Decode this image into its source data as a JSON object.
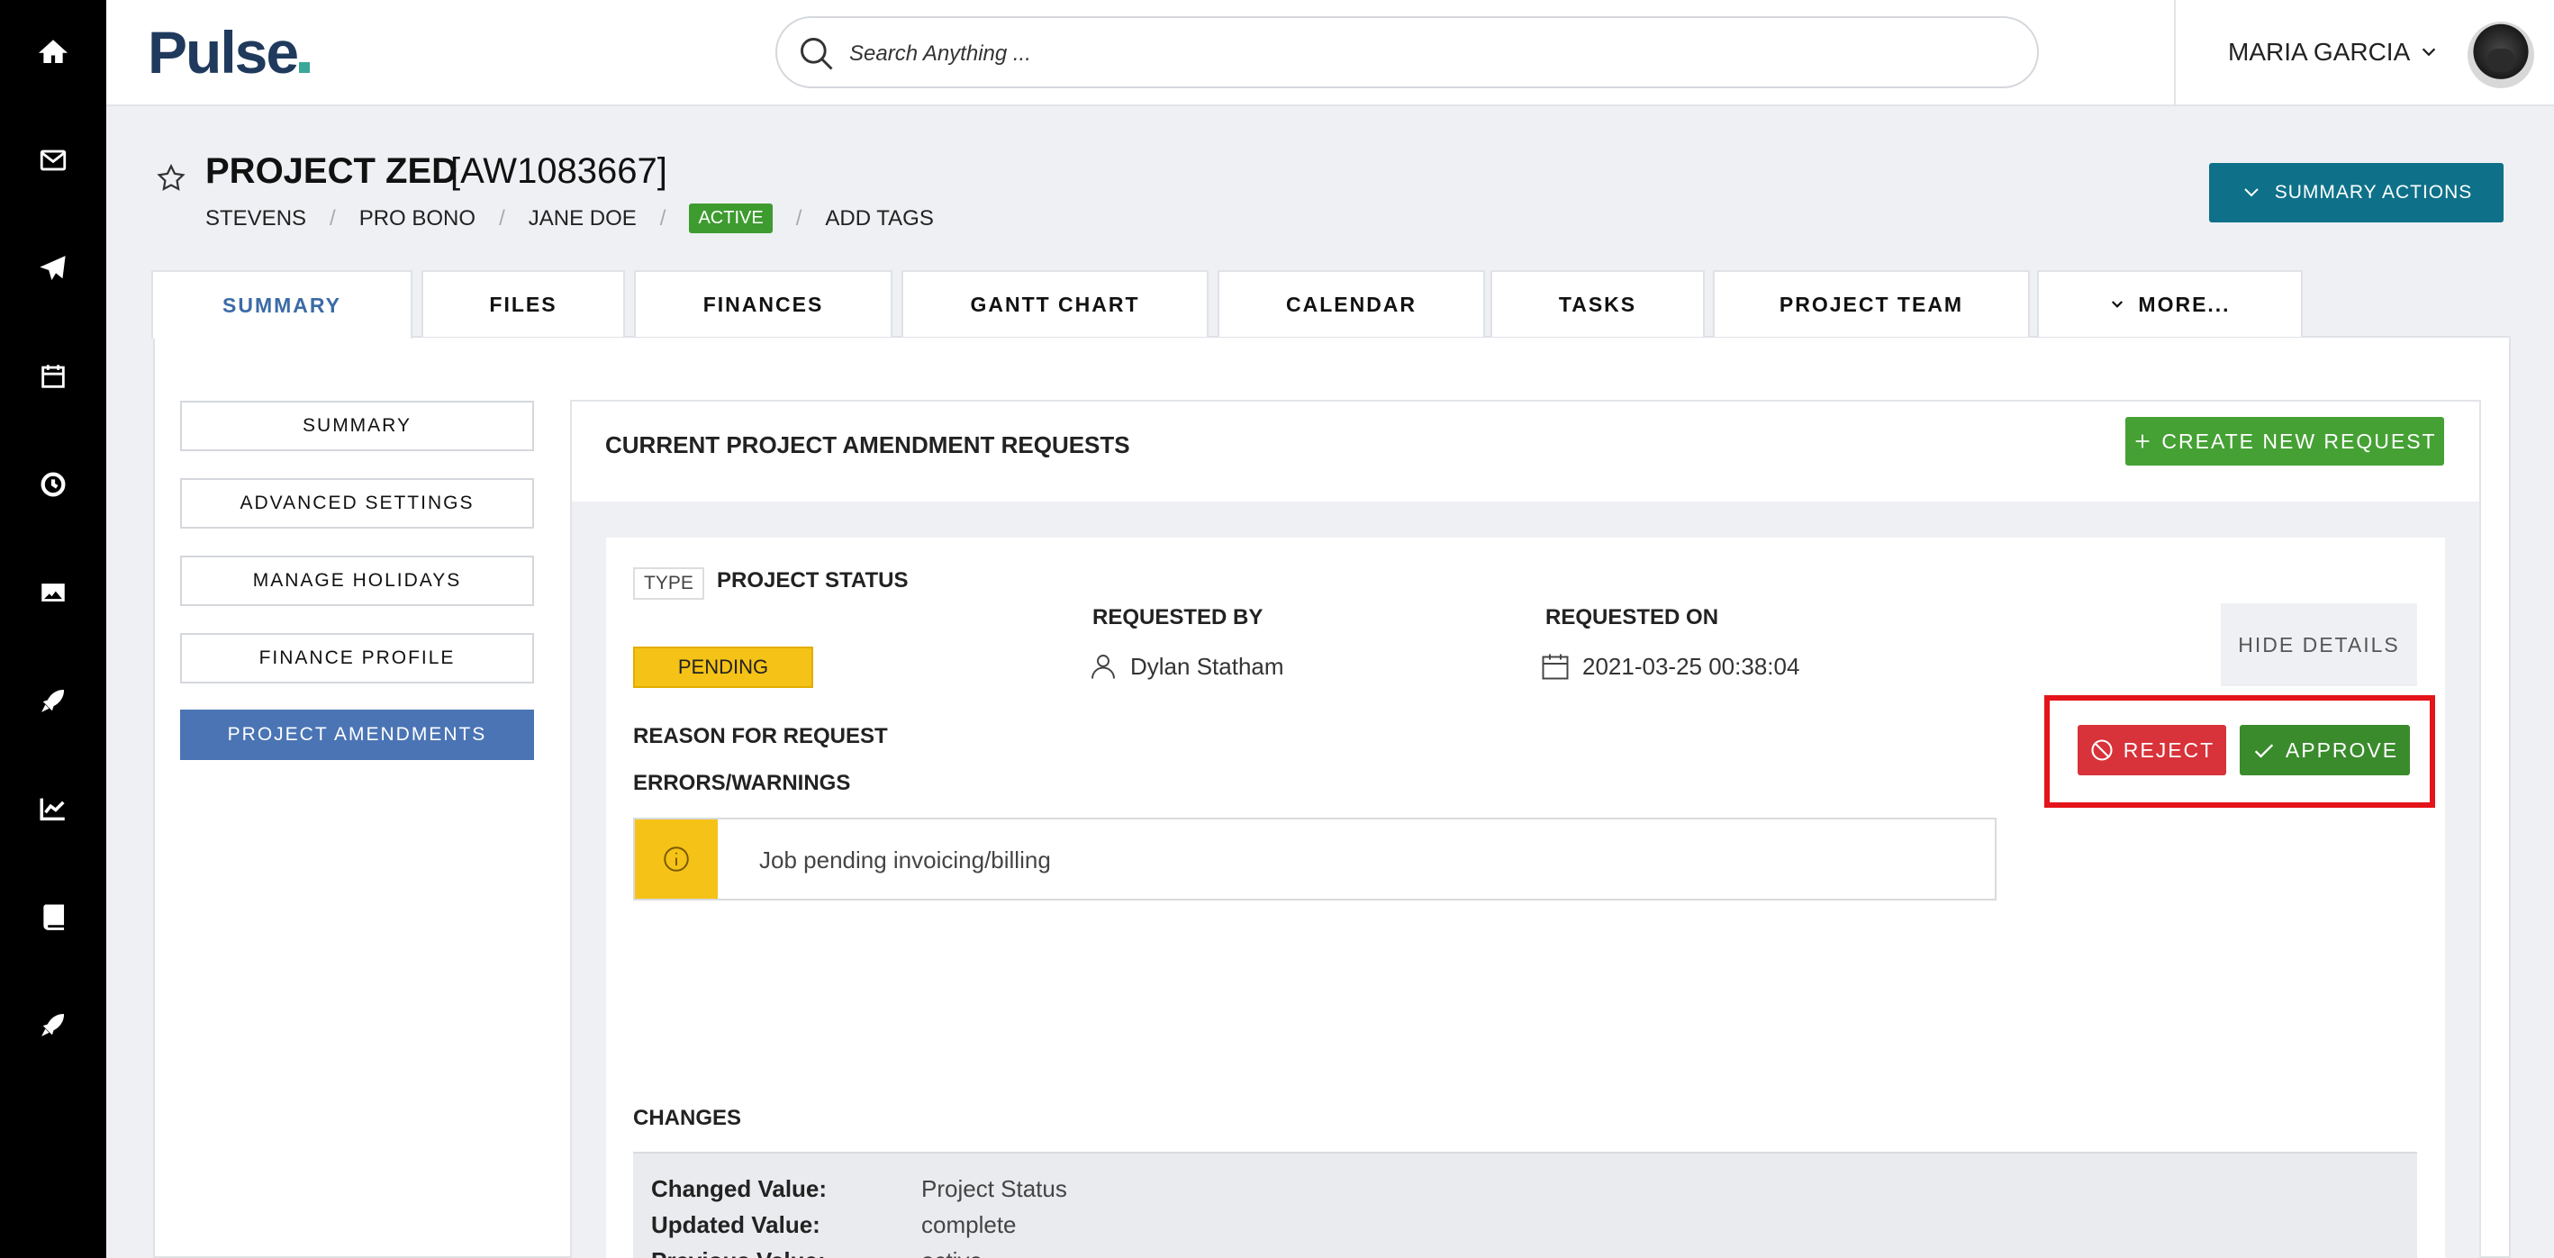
{
  "rail": {
    "items": [
      {
        "name": "home-icon"
      },
      {
        "name": "mail-icon"
      },
      {
        "name": "send-icon"
      },
      {
        "name": "calendar-icon"
      },
      {
        "name": "clock-icon"
      },
      {
        "name": "image-icon"
      },
      {
        "name": "rocket-icon"
      },
      {
        "name": "chart-icon"
      },
      {
        "name": "book-icon"
      },
      {
        "name": "rocket-icon"
      }
    ]
  },
  "topbar": {
    "logo": "Pulse",
    "search_placeholder": "Search Anything ...",
    "user_name": "MARIA GARCIA"
  },
  "project": {
    "title": "PROJECT ZED",
    "code": "[AW1083667]",
    "crumbs": [
      "STEVENS",
      "PRO BONO",
      "JANE DOE"
    ],
    "status": "ACTIVE",
    "add_tags": "ADD TAGS",
    "summary_actions": "SUMMARY ACTIONS"
  },
  "tabs": [
    "SUMMARY",
    "FILES",
    "FINANCES",
    "GANTT CHART",
    "CALENDAR",
    "TASKS",
    "PROJECT TEAM",
    "MORE..."
  ],
  "sidenav": [
    "SUMMARY",
    "ADVANCED SETTINGS",
    "MANAGE HOLIDAYS",
    "FINANCE PROFILE",
    "PROJECT AMENDMENTS"
  ],
  "amendments": {
    "title": "CURRENT PROJECT AMENDMENT REQUESTS",
    "create_button": "CREATE NEW REQUEST",
    "request": {
      "type_label": "TYPE",
      "type_value": "PROJECT STATUS",
      "status": "PENDING",
      "requested_by_label": "REQUESTED BY",
      "requested_by": "Dylan Statham",
      "requested_on_label": "REQUESTED ON",
      "requested_on": "2021-03-25 00:38:04",
      "hide_details": "HIDE DETAILS",
      "reject": "REJECT",
      "approve": "APPROVE",
      "reason_label": "REASON FOR REQUEST",
      "errors_label": "ERRORS/WARNINGS",
      "warning": "Job pending invoicing/billing",
      "changes_label": "CHANGES",
      "changes": [
        {
          "key": "Changed Value:",
          "value": "Project Status"
        },
        {
          "key": "Updated Value:",
          "value": "complete"
        },
        {
          "key": "Previous Value:",
          "value": "active"
        }
      ]
    }
  },
  "colors": {
    "accent_teal": "#0e7189",
    "active_blue": "#4a74b4",
    "green": "#46a135",
    "reject_red": "#d8323a",
    "pending_yellow": "#f5c217",
    "highlight_red": "#e3141a"
  }
}
